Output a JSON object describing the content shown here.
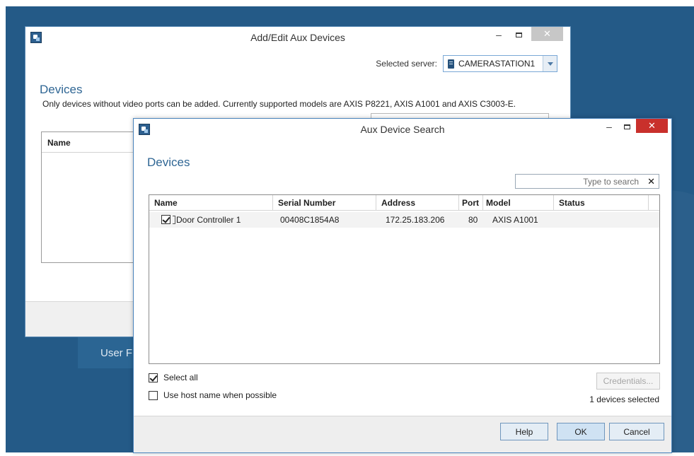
{
  "background": {
    "tile_label": "User F"
  },
  "back_window": {
    "title": "Add/Edit Aux Devices",
    "selected_server_label": "Selected server:",
    "server_value": "CAMERASTATION1",
    "heading": "Devices",
    "note": "Only devices without video ports can be added. Currently supported models are AXIS P8221, AXIS A1001 and AXIS C3003-E.",
    "list_column": "Name"
  },
  "front_window": {
    "title": "Aux Device Search",
    "heading": "Devices",
    "search": {
      "placeholder": "Type to search",
      "value": ""
    },
    "columns": [
      "Name",
      "Serial Number",
      "Address",
      "Port",
      "Model",
      "Status"
    ],
    "rows": [
      {
        "checked": true,
        "name": "Door Controller 1",
        "serial": "00408C1854A8",
        "address": "172.25.183.206",
        "port": "80",
        "model": "AXIS A1001",
        "status": ""
      }
    ],
    "select_all_label": "Select all",
    "select_all_checked": true,
    "use_host_name_label": "Use host name when possible",
    "use_host_name_checked": false,
    "credentials_label": "Credentials...",
    "selected_count": "1 devices selected",
    "buttons": {
      "help": "Help",
      "ok": "OK",
      "cancel": "Cancel"
    }
  },
  "colors": {
    "desktop": "#245a87",
    "heading": "#2f6694",
    "close_active": "#c9302c"
  }
}
